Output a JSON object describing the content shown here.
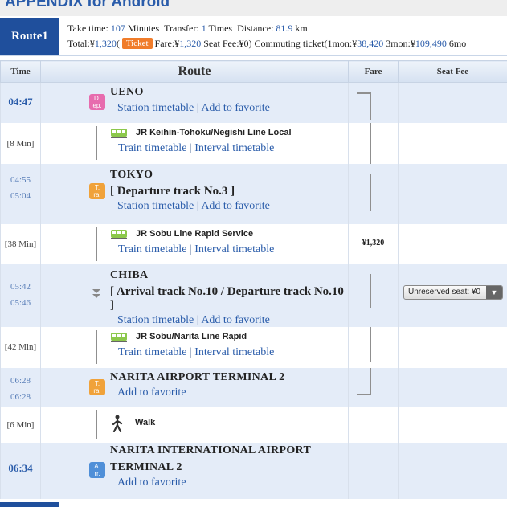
{
  "page_title": "APPENDIX for Android",
  "route": {
    "tab_label": "Route1",
    "summary": {
      "take_time_label": "Take time:",
      "take_time_value": "107",
      "take_time_unit": "Minutes",
      "transfer_label": "Transfer:",
      "transfer_value": "1",
      "transfer_unit": "Times",
      "distance_label": "Distance:",
      "distance_value": "81.9",
      "distance_unit": "km",
      "total_label": "Total:¥",
      "total_value": "1,320",
      "total_paren": "(",
      "ticket_badge": "Ticket",
      "fare_label": "Fare:¥",
      "fare_value": "1,320",
      "seat_label": "Seat Fee:¥",
      "seat_value": "0",
      "seat_close": ")",
      "commute_label": "Commuting ticket(1mon:¥",
      "commute_1mon": "38,420",
      "commute_3mon_label": "3mon:¥",
      "commute_3mon": "109,490",
      "commute_6mon_label": "6mo"
    }
  },
  "table": {
    "headers": {
      "time": "Time",
      "route": "Route",
      "fare": "Fare",
      "seat": "Seat Fee"
    }
  },
  "stations": {
    "ueno": {
      "time": "04:47",
      "name": "UENO",
      "badge": "D. ep.",
      "station_timetable": "Station timetable",
      "sep": "|",
      "favorite": "Add to favorite"
    },
    "tokyo": {
      "time_arr": "04:55",
      "time_dep": "05:04",
      "name": "TOKYO",
      "badge": "T. ra.",
      "track": "[ Departure track No.3 ]",
      "station_timetable": "Station timetable",
      "sep": "|",
      "favorite": "Add to favorite"
    },
    "chiba": {
      "time_arr": "05:42",
      "time_dep": "05:46",
      "name": "CHIBA",
      "track": "[ Arrival track No.10 / Departure track No.10 ]",
      "station_timetable": "Station timetable",
      "sep": "|",
      "favorite": "Add to favorite"
    },
    "narita_t2": {
      "time_arr": "06:28",
      "time_dep": "06:28",
      "name": "NARITA AIRPORT TERMINAL 2",
      "badge": "T. ra.",
      "favorite": "Add to favorite"
    },
    "narita_int": {
      "time": "06:34",
      "name_line1": "NARITA INTERNATIONAL AIRPORT",
      "name_line2": "TERMINAL 2",
      "badge": "A. rr.",
      "favorite": "Add to favorite"
    }
  },
  "lines": {
    "keihin": {
      "duration": "[8 Min]",
      "name": "JR Keihin-Tohoku/Negishi Line Local",
      "train_timetable": "Train timetable",
      "sep": "|",
      "interval": "Interval timetable"
    },
    "sobu_rapid": {
      "duration": "[38 Min]",
      "name": "JR Sobu Line Rapid Service",
      "train_timetable": "Train timetable",
      "sep": "|",
      "interval": "Interval timetable",
      "fare": "¥1,320"
    },
    "sobu_narita": {
      "duration": "[42 Min]",
      "name": "JR Sobu/Narita Line Rapid",
      "train_timetable": "Train timetable",
      "sep": "|",
      "interval": "Interval timetable"
    },
    "walk": {
      "duration": "[6 Min]",
      "name": "Walk"
    }
  },
  "seat_select": {
    "value": "Unreserved seat: ¥0",
    "arrow": "▼"
  },
  "colors": {
    "accent": "#1f4f9c",
    "link": "#2a5caa",
    "station_bg": "#e4ecf8",
    "ticket": "#f07c2a"
  }
}
